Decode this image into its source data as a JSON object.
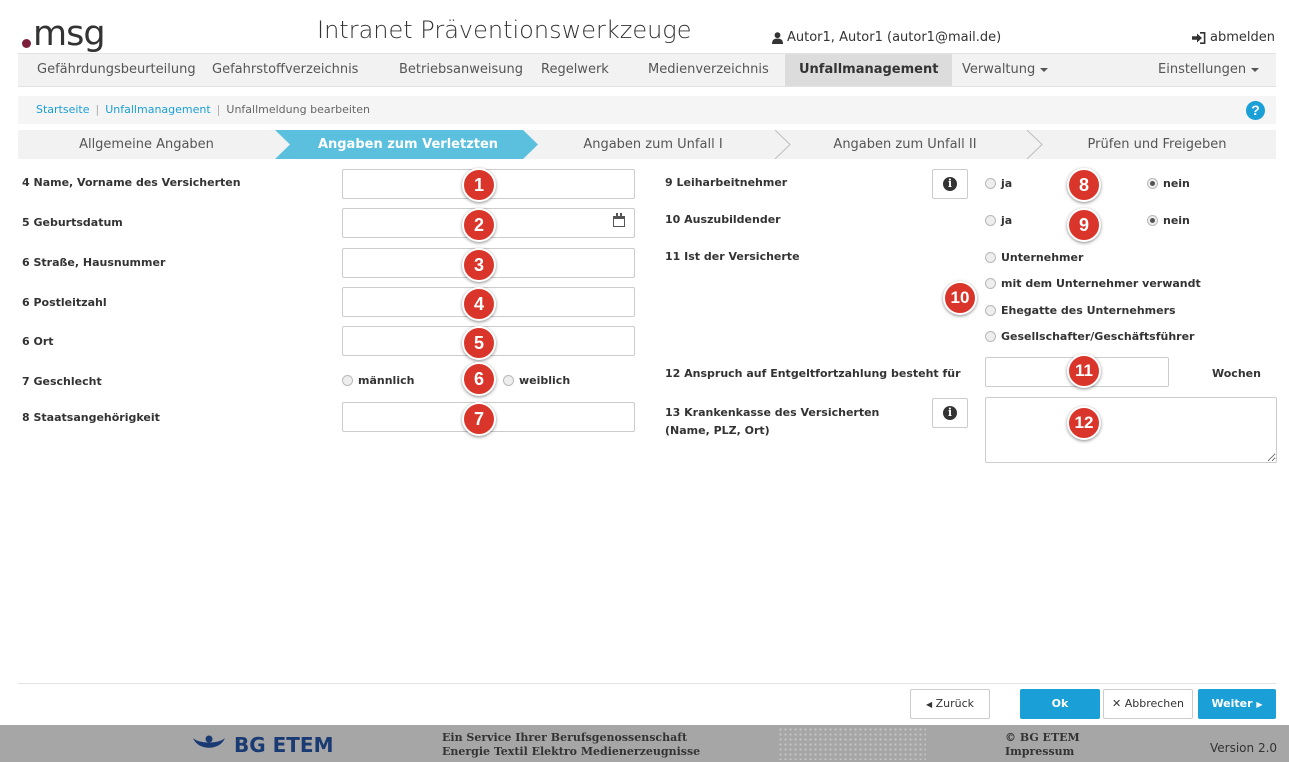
{
  "header": {
    "logo_text": "msg",
    "app_title": "Intranet Präventionswerkzeuge",
    "user": "Autor1, Autor1 (autor1@mail.de)",
    "logout_label": "abmelden"
  },
  "nav": {
    "items": [
      {
        "label": "Gefährdungsbeurteilung"
      },
      {
        "label": "Gefahrstoffverzeichnis"
      },
      {
        "label": "Betriebsanweisung"
      },
      {
        "label": "Regelwerk"
      },
      {
        "label": "Medienverzeichnis"
      },
      {
        "label": "Unfallmanagement",
        "active": true
      },
      {
        "label": "Verwaltung",
        "dropdown": true
      }
    ],
    "settings_label": "Einstellungen"
  },
  "breadcrumb": {
    "items": [
      "Startseite",
      "Unfallmanagement"
    ],
    "current": "Unfallmeldung bearbeiten",
    "help_icon": "?"
  },
  "wizard": {
    "steps": [
      {
        "label": "Allgemeine Angaben"
      },
      {
        "label": "Angaben zum Verletzten",
        "active": true
      },
      {
        "label": "Angaben zum Unfall I"
      },
      {
        "label": "Angaben zum Unfall II"
      },
      {
        "label": "Prüfen und Freigeben"
      }
    ]
  },
  "form": {
    "name_label": "4 Name, Vorname des Versicherten",
    "name_value": "",
    "birth_label": "5 Geburtsdatum",
    "birth_value": "",
    "street_label": "6 Straße, Hausnummer",
    "street_value": "",
    "zip_label": "6 Postleitzahl",
    "zip_value": "",
    "city_label": "6 Ort",
    "city_value": "",
    "gender_label": "7 Geschlecht",
    "gender_male": "männlich",
    "gender_female": "weiblich",
    "nationality_label": "8 Staatsangehörigkeit",
    "nationality_value": "",
    "temp_worker_label": "9 Leiharbeitnehmer",
    "temp_worker_yes": "ja",
    "temp_worker_no": "nein",
    "temp_worker_selected": "nein",
    "trainee_label": "10 Auszubildender",
    "trainee_yes": "ja",
    "trainee_no": "nein",
    "trainee_selected": "nein",
    "insured_is_label": "11 Ist der Versicherte",
    "insured_is_options": [
      "Unternehmer",
      "mit dem Unternehmer verwandt",
      "Ehegatte des Unternehmers",
      "Gesellschafter/Geschäftsführer"
    ],
    "pay_continuation_label": "12 Anspruch auf Entgeltfortzahlung besteht für",
    "pay_continuation_value": "",
    "pay_continuation_unit": "Wochen",
    "health_insurance_label_1": "13 Krankenkasse des Versicherten",
    "health_insurance_label_2": "(Name, PLZ, Ort)",
    "health_insurance_value": "",
    "info_icon_glyph": "i"
  },
  "badges": [
    "1",
    "2",
    "3",
    "4",
    "5",
    "6",
    "7",
    "8",
    "9",
    "10",
    "11",
    "12"
  ],
  "buttons": {
    "back": "Zurück",
    "ok": "Ok",
    "cancel": "Abbrechen",
    "next": "Weiter"
  },
  "footer": {
    "brand": "BG ETEM",
    "service_line_1": "Ein Service Ihrer Berufsgenossenschaft",
    "service_line_2": "Energie Textil Elektro Medienerzeugnisse",
    "copyright": "© BG ETEM",
    "imprint": "Impressum",
    "version": "Version 2.0"
  },
  "colors": {
    "accent": "#1a9fd6",
    "badge": "#d9352b",
    "logo_dot": "#7d1f3c",
    "footer_bg": "#a6a6a6",
    "footer_brand": "#1a3a73"
  },
  "icons": {
    "user": "user-icon",
    "logout": "sign-out-icon",
    "help": "question-circle-icon",
    "calendar": "calendar-icon",
    "info": "info-circle-icon",
    "back": "caret-left-icon",
    "cancel": "times-icon",
    "next": "caret-right-icon"
  }
}
